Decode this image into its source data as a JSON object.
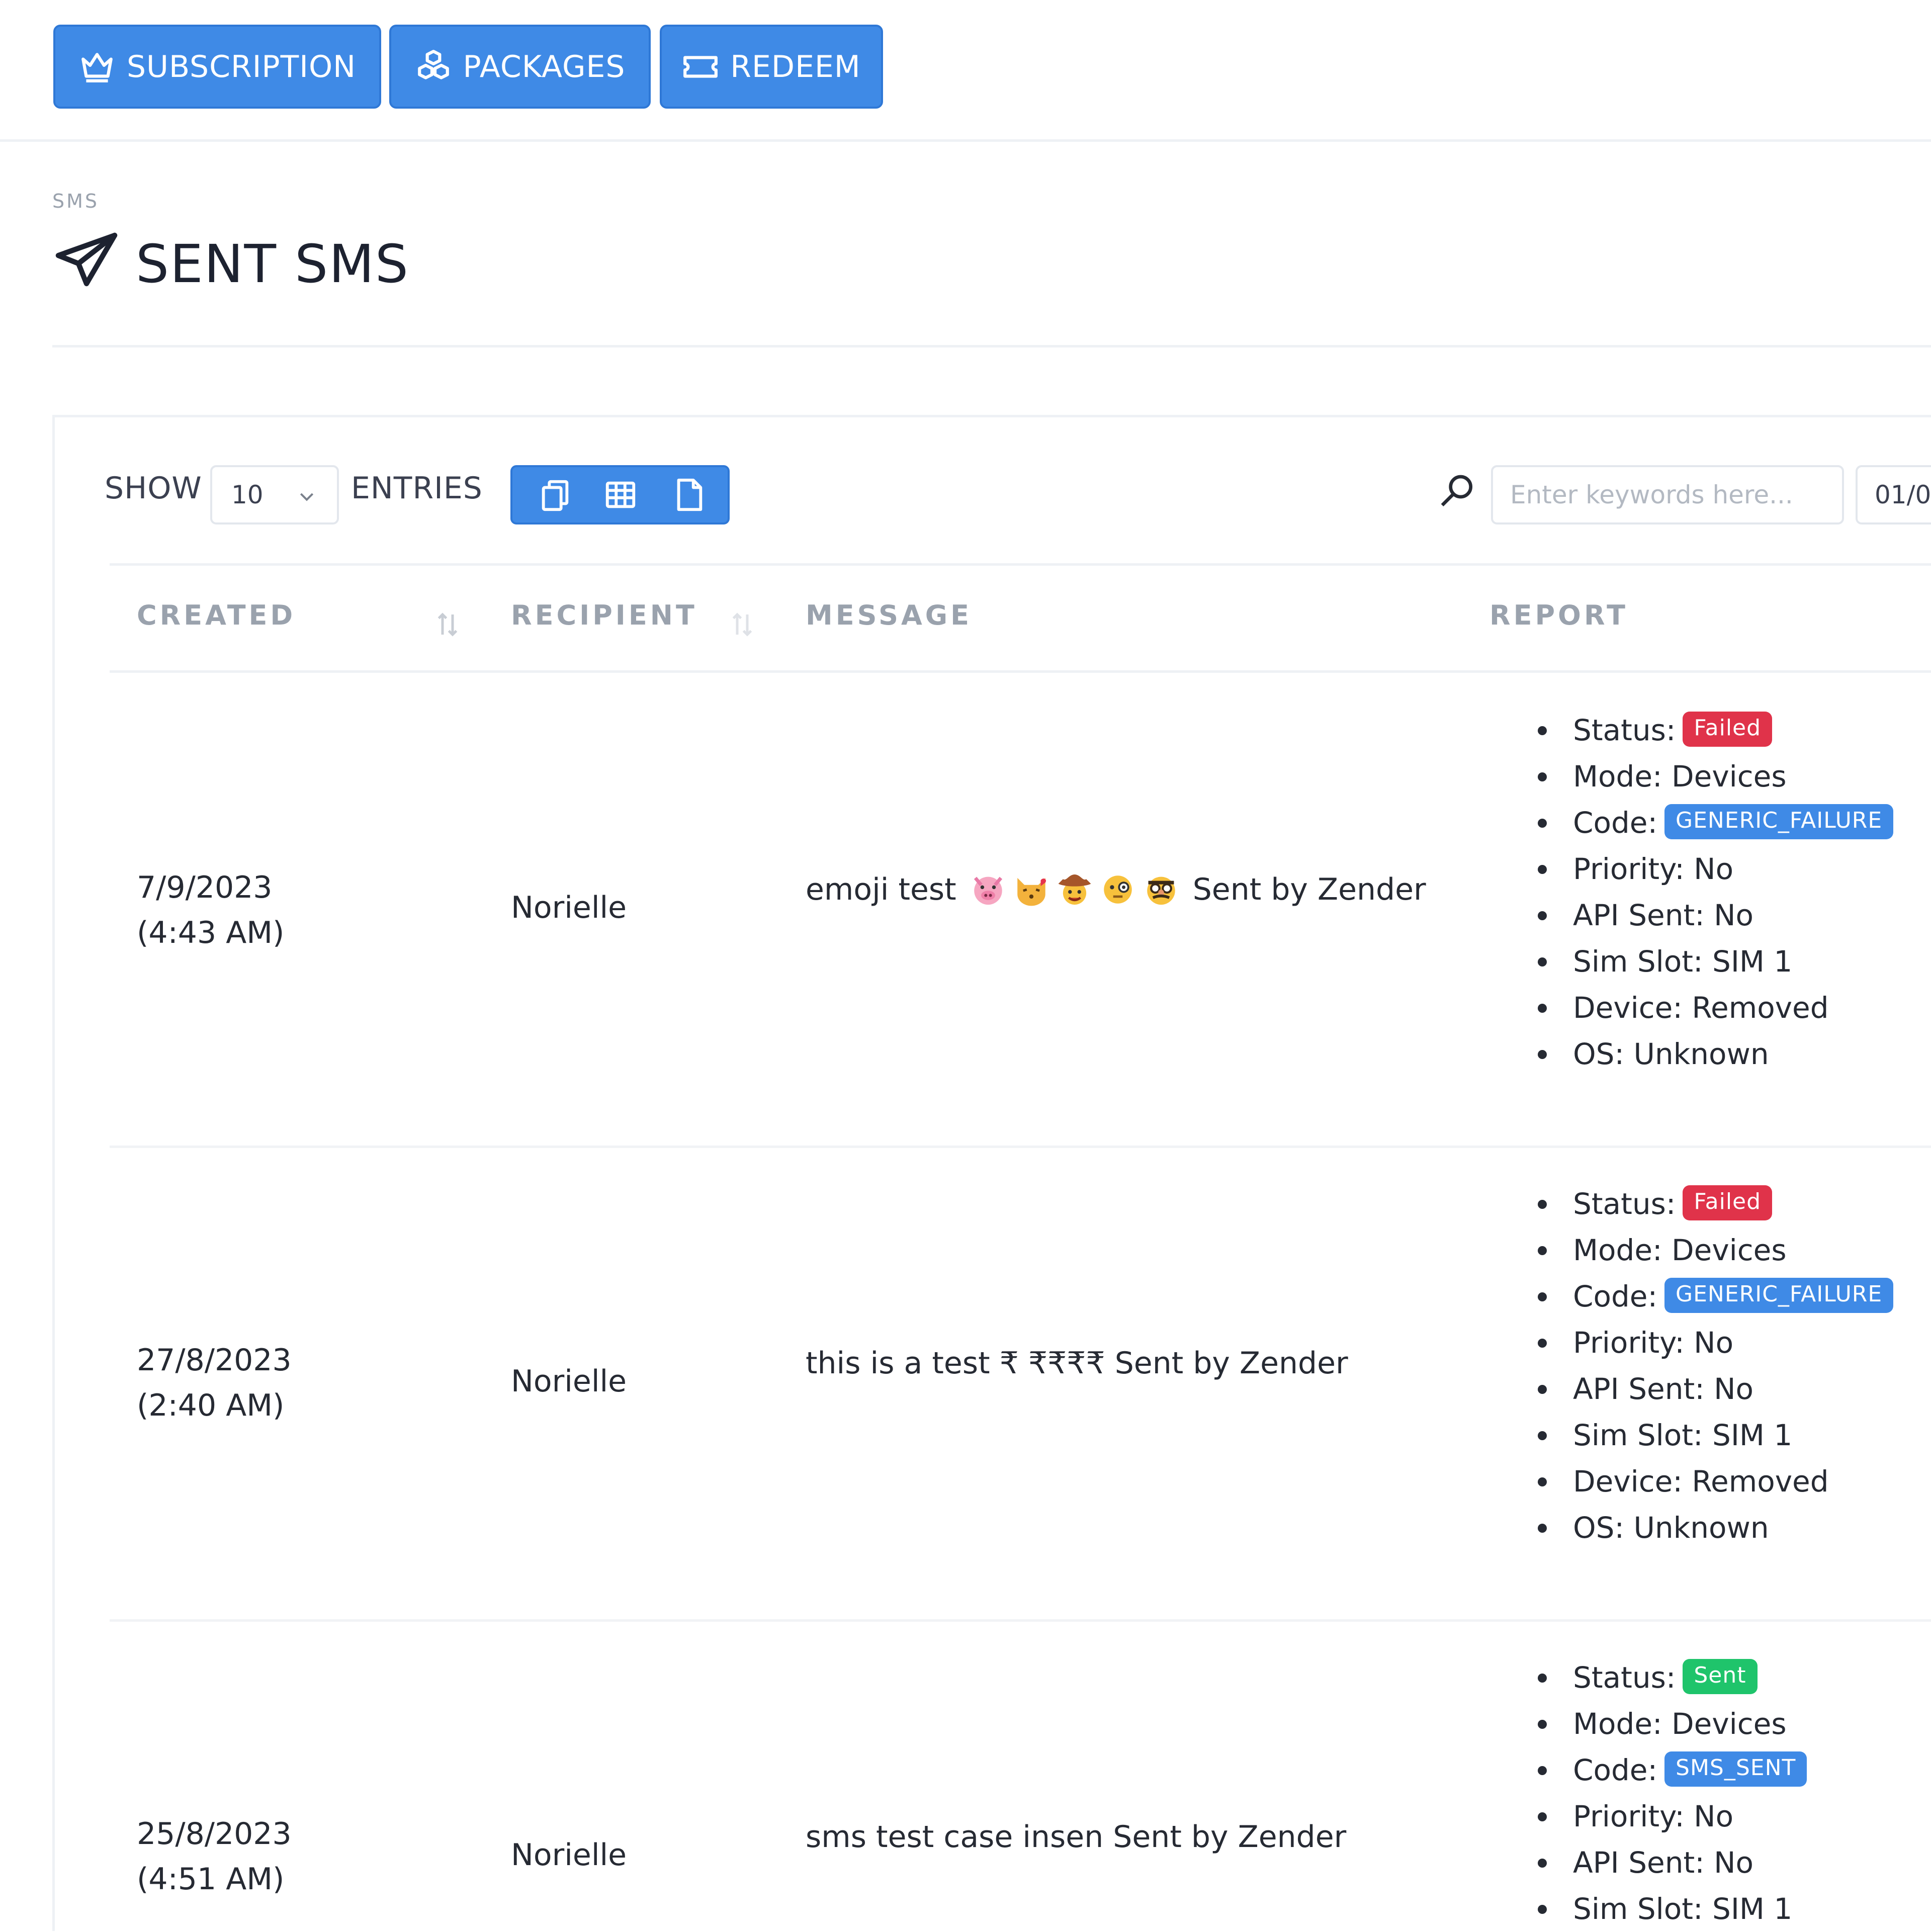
{
  "toolbar": {
    "subscription_label": "SUBSCRIPTION",
    "packages_label": "PACKAGES",
    "redeem_label": "REDEEM"
  },
  "header": {
    "breadcrumb": "SMS",
    "title": "SENT SMS"
  },
  "controls": {
    "show_label": "SHOW",
    "entries_value": "10",
    "entries_label": "ENTRIES",
    "search_placeholder": "Enter keywords here...",
    "date_value": "01/0"
  },
  "table": {
    "columns": [
      "CREATED",
      "RECIPIENT",
      "MESSAGE",
      "REPORT"
    ],
    "rows": [
      {
        "created_date": "7/9/2023",
        "created_time": "(4:43 AM)",
        "recipient": "Norielle",
        "message_prefix": "emoji test",
        "message_suffix": "Sent by Zender",
        "emojis": [
          "pig-face-emoji",
          "kissing-cat-emoji",
          "cowboy-face-emoji",
          "monocle-face-emoji",
          "disguised-face-emoji"
        ],
        "report": {
          "status_label": "Status:",
          "status": "Failed",
          "mode": "Mode: Devices",
          "code_label": "Code:",
          "code": "GENERIC_FAILURE",
          "priority": "Priority: No",
          "api_sent": "API Sent: No",
          "sim_slot": "Sim Slot: SIM 1",
          "device": "Device: Removed",
          "os": "OS: Unknown"
        }
      },
      {
        "created_date": "27/8/2023",
        "created_time": "(2:40 AM)",
        "recipient": "Norielle",
        "message": "this is a test ₹ ₹₹₹₹ Sent by Zender",
        "report": {
          "status_label": "Status:",
          "status": "Failed",
          "mode": "Mode: Devices",
          "code_label": "Code:",
          "code": "GENERIC_FAILURE",
          "priority": "Priority: No",
          "api_sent": "API Sent: No",
          "sim_slot": "Sim Slot: SIM 1",
          "device": "Device: Removed",
          "os": "OS: Unknown"
        }
      },
      {
        "created_date": "25/8/2023",
        "created_time": "(4:51 AM)",
        "recipient": "Norielle",
        "message": "sms test case insen Sent by Zender",
        "report": {
          "status_label": "Status:",
          "status": "Sent",
          "mode": "Mode: Devices",
          "code_label": "Code:",
          "code": "SMS_SENT",
          "priority": "Priority: No",
          "api_sent": "API Sent: No",
          "sim_slot": "Sim Slot: SIM 1"
        }
      }
    ]
  },
  "colors": {
    "primary": "#3f8ae6",
    "failed": "#e0334a",
    "sent": "#1fc46b"
  }
}
